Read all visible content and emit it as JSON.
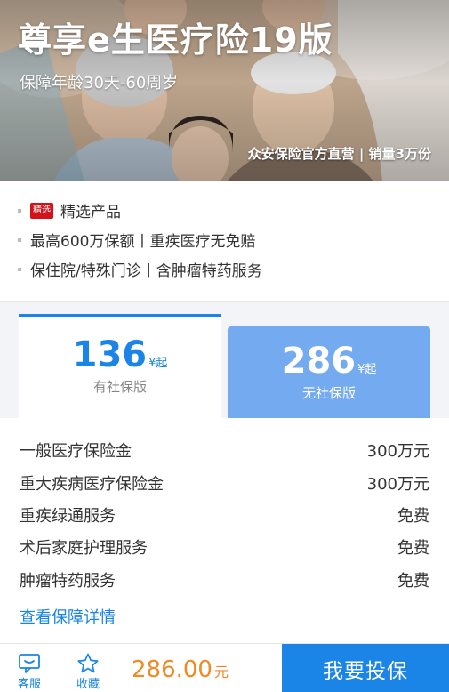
{
  "hero": {
    "title": "尊享e生医疗险19版",
    "subtitle": "保障年龄30天-60周岁",
    "badge": "众安保险官方直营 | 销量3万份"
  },
  "features": {
    "tag": "精选",
    "items": [
      "精选产品",
      "最高600万保额丨重疾医疗无免赔",
      "保住院/特殊门诊丨含肿瘤特药服务"
    ]
  },
  "plans": [
    {
      "price": "136",
      "suffix": "¥起",
      "label": "有社保版",
      "active": true
    },
    {
      "price": "286",
      "suffix": "¥起",
      "label": "无社保版",
      "active": false
    }
  ],
  "coverage": {
    "rows": [
      {
        "name": "一般医疗保险金",
        "value": "300万元"
      },
      {
        "name": "重大疾病医疗保险金",
        "value": "300万元"
      },
      {
        "name": "重疾绿通服务",
        "value": "免费"
      },
      {
        "name": "术后家庭护理服务",
        "value": "免费"
      },
      {
        "name": "肿瘤特药服务",
        "value": "免费"
      }
    ],
    "link": "查看保障详情"
  },
  "bottom": {
    "service_label": "客服",
    "service_icon": "chat-icon",
    "fav_label": "收藏",
    "fav_icon": "star-icon",
    "price": "286.00",
    "price_unit": "元",
    "cta": "我要投保"
  },
  "colors": {
    "accent": "#1a85e6",
    "price": "#f08a24",
    "tag": "#d4121b",
    "inactive_plan": "#74aaf0"
  }
}
